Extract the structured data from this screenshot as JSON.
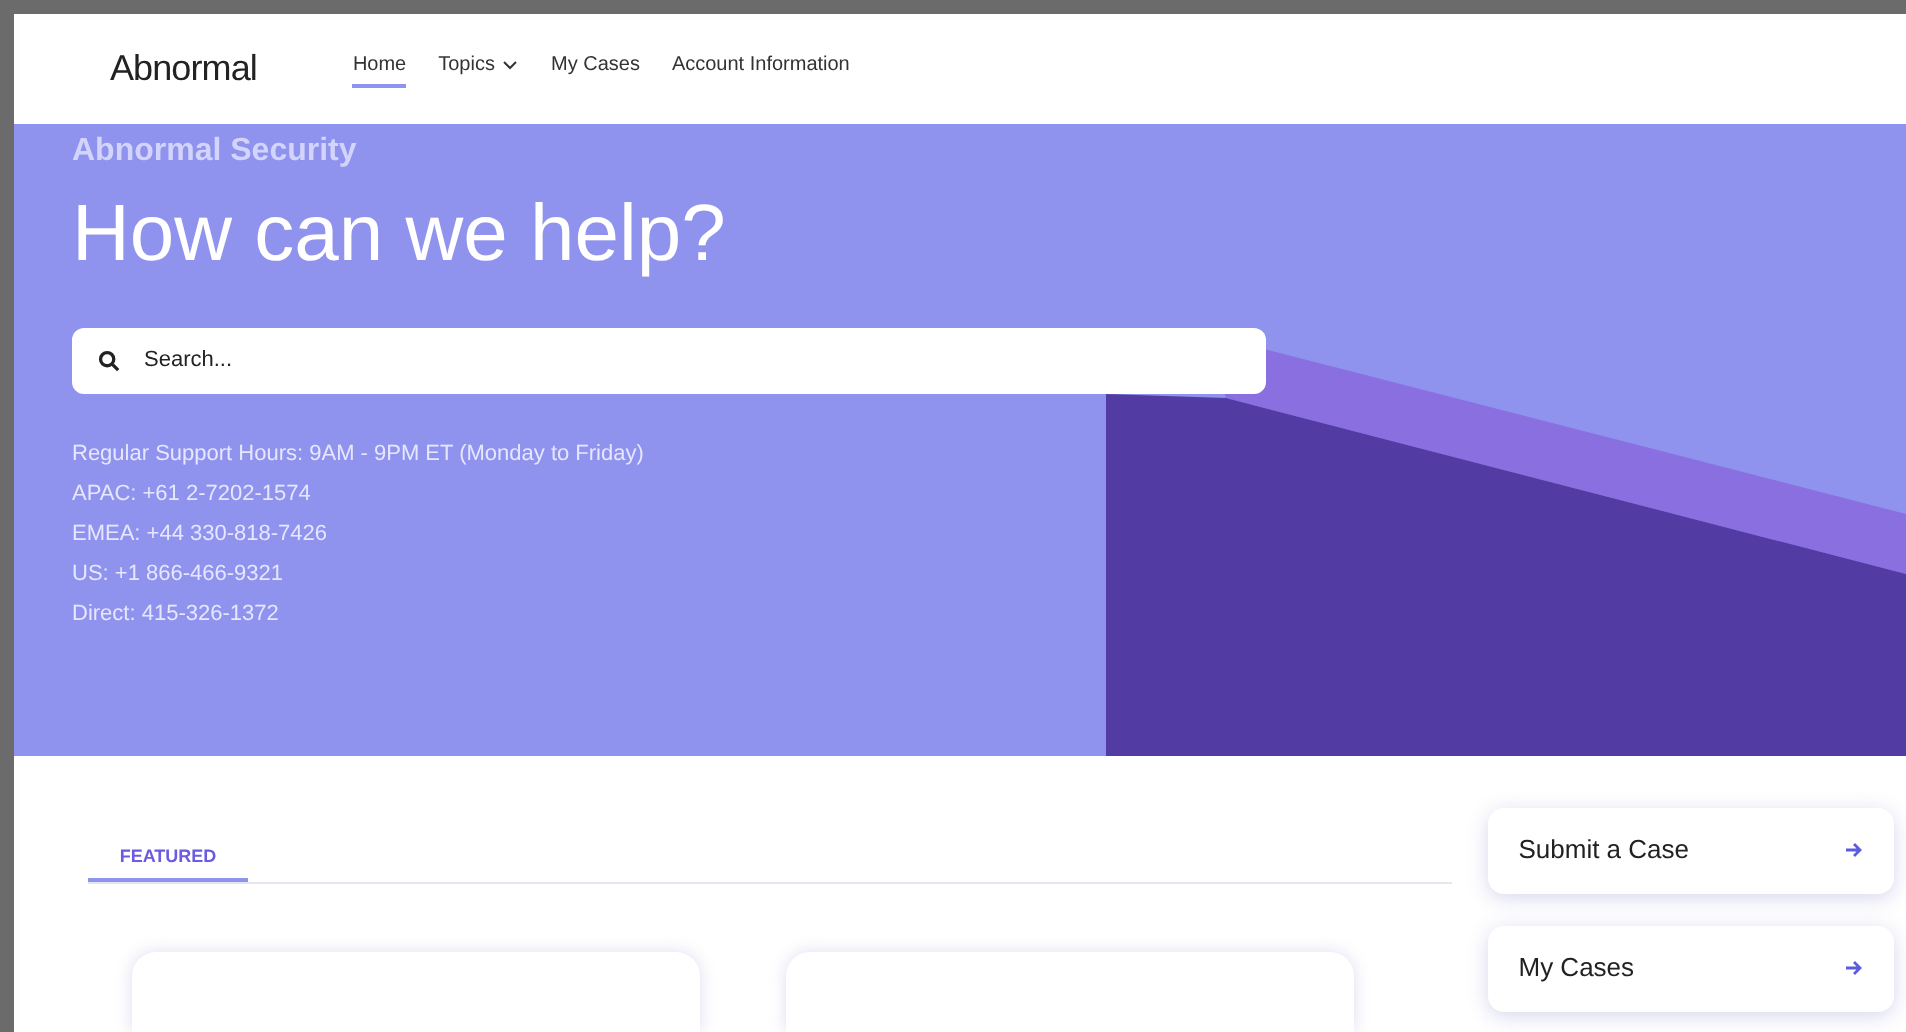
{
  "header": {
    "logo": "Abnormal",
    "nav": [
      {
        "label": "Home",
        "selected": true,
        "dropdown": false
      },
      {
        "label": "Topics",
        "selected": false,
        "dropdown": true
      },
      {
        "label": "My Cases",
        "selected": false,
        "dropdown": false
      },
      {
        "label": "Account Information",
        "selected": false,
        "dropdown": false
      }
    ]
  },
  "hero": {
    "eyebrow": "Abnormal Security",
    "title": "How can we help?",
    "search": {
      "placeholder": "Search..."
    },
    "support_lines": [
      "Regular Support Hours: 9AM - 9PM ET (Monday to Friday)",
      "APAC: +61 2-7202-1574",
      "EMEA: +44 330-818-7426",
      "US: +1 866-466-9321",
      "Direct: 415-326-1372"
    ]
  },
  "tabs": [
    {
      "label": "FEATURED",
      "selected": true
    }
  ],
  "cards": [
    {
      "kind": "blank"
    },
    {
      "kind": "blank"
    }
  ],
  "actions": [
    {
      "label": "Submit a Case"
    },
    {
      "label": "My Cases"
    }
  ]
}
